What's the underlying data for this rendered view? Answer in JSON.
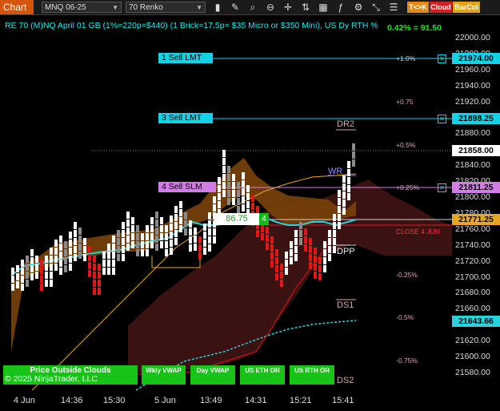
{
  "toolbar": {
    "tab_label": "Chart",
    "instrument": "MNQ 06-25",
    "bar_type": "70 Renko",
    "tc_label": "T<>K",
    "cloud_label": "Cloud",
    "barcolor_label": "BarCol"
  },
  "chart": {
    "title": "RE 70 (M)NQ April 01 GB (1%=220p=$440) (1 Brick=17.5p= $35 Micro or $350 Mini), US Dy RTH %",
    "top_right_stat": "0.42% = 91.50",
    "copyright": "© 2025 NinjaTrader, LLC",
    "price_labels": [
      "22000.00",
      "21980.00",
      "21960.00",
      "21940.00",
      "21920.00",
      "21900.00",
      "21880.00",
      "21860.00",
      "21840.00",
      "21820.00",
      "21800.00",
      "21780.00",
      "21760.00",
      "21740.00",
      "21720.00",
      "21700.00",
      "21680.00",
      "21660.00",
      "21640.00",
      "21620.00",
      "21600.00",
      "21580.00"
    ],
    "price_boxes": {
      "sell1": "21974.00",
      "sell3": "21898.25",
      "last": "21858.00",
      "sell4": "21811.25",
      "cloud": "21771.25",
      "lower": "21643.66"
    },
    "time_labels": [
      "4 Jun",
      "14:36",
      "15:30",
      "5 Jun",
      "13:49",
      "14:31",
      "15:21",
      "15:41"
    ],
    "orders": {
      "sell1": "1 Sell LMT",
      "sell3": "3 Sell LMT",
      "sell4": "4 Sell SLM"
    },
    "position": {
      "price": "86.75",
      "qty": "4"
    },
    "pct_levels": {
      "p10": "+1.0%",
      "p075": "+0.75",
      "p05": "+0.5%",
      "p025": "+0.25%",
      "close": "CLOSE 4 JUN",
      "m025": "-0.25%",
      "m05": "-0.5%",
      "m075": "-0.75%"
    },
    "levels": {
      "dr2": "DR2",
      "wr": "WR",
      "dpp": "DPP",
      "ds1": "DS1",
      "ds2": "DS2"
    },
    "buttons": {
      "clouds": "Price Outside Clouds",
      "wkly": "Wkly VWAP",
      "day": "Day VWAP",
      "eth": "US ETH OR",
      "rth": "US RTH OR"
    },
    "colors": {
      "order_line": "#14d2e6",
      "sell4_line": "#d27de6",
      "up_brick": "#ffffff",
      "down_brick": "#e81414",
      "cloud_upper": "#8a4a0a",
      "cloud_lower": "#3a1212",
      "vwap": "#27d3dc",
      "ma": "#e8a424",
      "accent": "#d3540a"
    }
  }
}
